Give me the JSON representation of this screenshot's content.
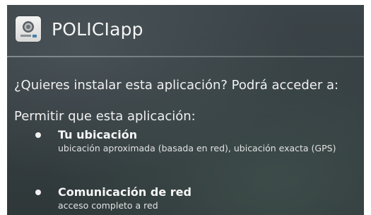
{
  "app": {
    "title": "POLICIapp",
    "icon": "police-shield-icon"
  },
  "install": {
    "question": "¿Quieres instalar esta aplicación? Podrá acceder a:",
    "permit_label": "Permitir que esta aplicación:",
    "permissions": [
      {
        "title": "Tu ubicación",
        "description": "ubicación aproximada (basada en red), ubicación exacta (GPS)"
      },
      {
        "title": "Comunicación de red",
        "description": "acceso completo a red"
      }
    ]
  },
  "colors": {
    "background": "#353d41",
    "text": "#f0f0f0",
    "divider": "#a9b4b8"
  }
}
